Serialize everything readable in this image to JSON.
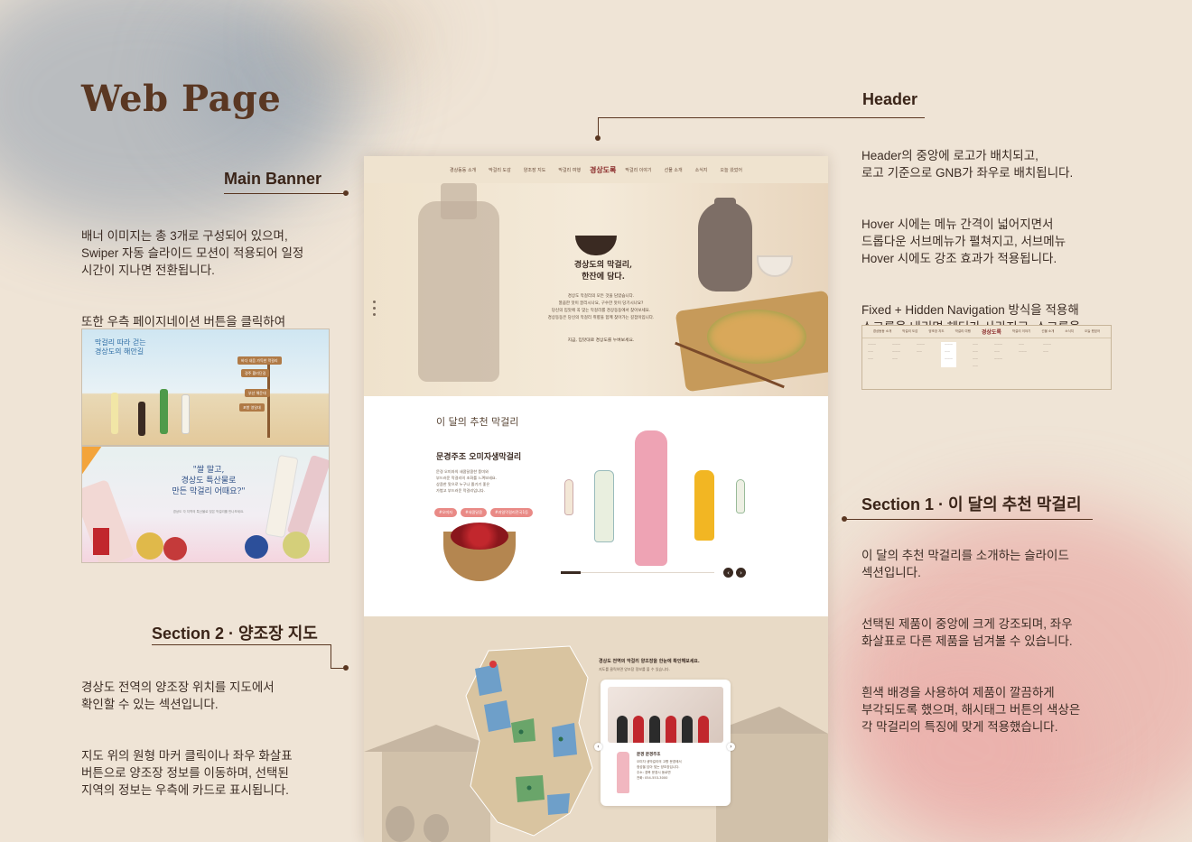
{
  "page": {
    "title": "Web Page"
  },
  "main_banner": {
    "title": "Main Banner",
    "desc1": "배너 이미지는 총 3개로 구성되어 있으며,\nSwiper 자동 슬라이드 모션이 적용되어 일정\n시간이 지나면 전환됩니다.",
    "desc2": "또한 우측 페이지네이션 버튼을 클릭하여\n직접 배너를 넘겨볼 수 있습니다."
  },
  "section2": {
    "title": "Section 2 · 양조장 지도",
    "desc1": "경상도 전역의 양조장 위치를 지도에서\n확인할 수 있는 섹션입니다.",
    "desc2": "지도 위의 원형 마커 클릭이나 좌우 화살표\n버튼으로 양조장 정보를 이동하며, 선택된\n지역의 정보는 우측에 카드로 표시됩니다."
  },
  "header_info": {
    "title": "Header",
    "desc1": "Header의 중앙에 로고가 배치되고,\n로고 기준으로 GNB가 좌우로 배치됩니다.",
    "desc2": "Hover 시에는 메뉴 간격이 넓어지면서\n드롭다운 서브메뉴가 펼쳐지고, 서브메뉴\nHover 시에도 강조 효과가 적용됩니다.",
    "desc3": "Fixed + Hidden Navigation 방식을 적용해\n스크롤을 내리면 헤더가 사라지고, 스크롤을\n올리거나 상단에 hover 시 헤더가 다시\n나타나도록 디자인했습니다."
  },
  "section1": {
    "title": "Section 1 · 이 달의 추천 막걸리",
    "desc1": "이 달의 추천 막걸리를 소개하는 슬라이드\n섹션입니다.",
    "desc2": "선택된 제품이 중앙에 크게 강조되며, 좌우\n화살표로 다른 제품을 넘겨볼 수 있습니다.",
    "desc3": "흰색 배경을 사용하여 제품이 깔끔하게\n부각되도록 했으며, 해시태그 버튼의 색상은\n각 막걸리의 특징에 맞게 적용했습니다."
  },
  "mock": {
    "logo": "경상도록",
    "gnb_left": [
      "경상동동 소개",
      "막걸리 도감",
      "양조장 지도",
      "막걸리 여행"
    ],
    "gnb_right": [
      "막걸리 이야기",
      "선물 소개",
      "소식지",
      "오늘 왔었어"
    ],
    "banner_tagline": "경상도의 막걸리,\n한잔에 담다.",
    "banner_text": "경상도 막걸리의 모든 것을 담았습니다.\n깔끔한 맛이 끌리시나요, 구수한 맛이 당기시나요?\n당신의 입맛에 꼭 맞는 막걸리를 경상동동에서 찾아보세요.\n경상동동은 당신의 막걸리 취향을 함께 찾아가는 길잡이입니다.",
    "banner_cta": "지금, 입맛대로 경상도를 누벼보세요.",
    "sec1_title": "이 달의 추천 막걸리",
    "sec1_product": "문경주조 오미자생막걸리",
    "sec1_desc": "문경 오미자의 새콤달콤한 풍미와\n부드러운 막걸리의 조화를 느껴보세요.\n상큼한 맛으로 누구나 즐기기 좋은\n가볍고 부드러운 막걸리입니다.",
    "sec1_tags": [
      "#오미자",
      "#새콤달콤",
      "#과일막걸리전국1등"
    ],
    "sec2_title": "경상도 전역의 막걸리 양조장을 한눈에 확인해보세요.",
    "sec2_sub": "지도를 클릭하면 양조장 정보를 볼 수 있습니다.",
    "sec2_brewery": "문경 문경주조",
    "sec2_info": "오미자 생막걸리의 고향 문경에서\n정성을 담아 빚는 양조장입니다.\n주소: 경북 문경시 동로면\n전화: 054-553-3000"
  },
  "thumb1": {
    "title": "막걸리 따라 걷는\n경상도의 해안길",
    "signs": [
      "바다 내음 가득한 막걸리",
      "경주 황리단길",
      "부산 해운대",
      "포항 영일대"
    ]
  },
  "thumb2": {
    "quote": "\"쌀 말고,\n경상도 특산물로\n만든 막걸리 어때요?\"",
    "sub": "경상도 각 지역의 특산물로 빚은 막걸리를 만나보세요."
  },
  "nav_preview": {
    "logo": "경상도록",
    "items": [
      "경상동동 소개",
      "막걸리 도감",
      "양조장 지도",
      "막걸리 여행",
      "막걸리 이야기",
      "선물 소개",
      "소식지",
      "오늘 왔었어"
    ]
  },
  "colors": {
    "accent_brown": "#5a3722",
    "tag_pink": "#e98a86",
    "map_green": "#6aa56a",
    "map_blue": "#6e9fc9"
  }
}
